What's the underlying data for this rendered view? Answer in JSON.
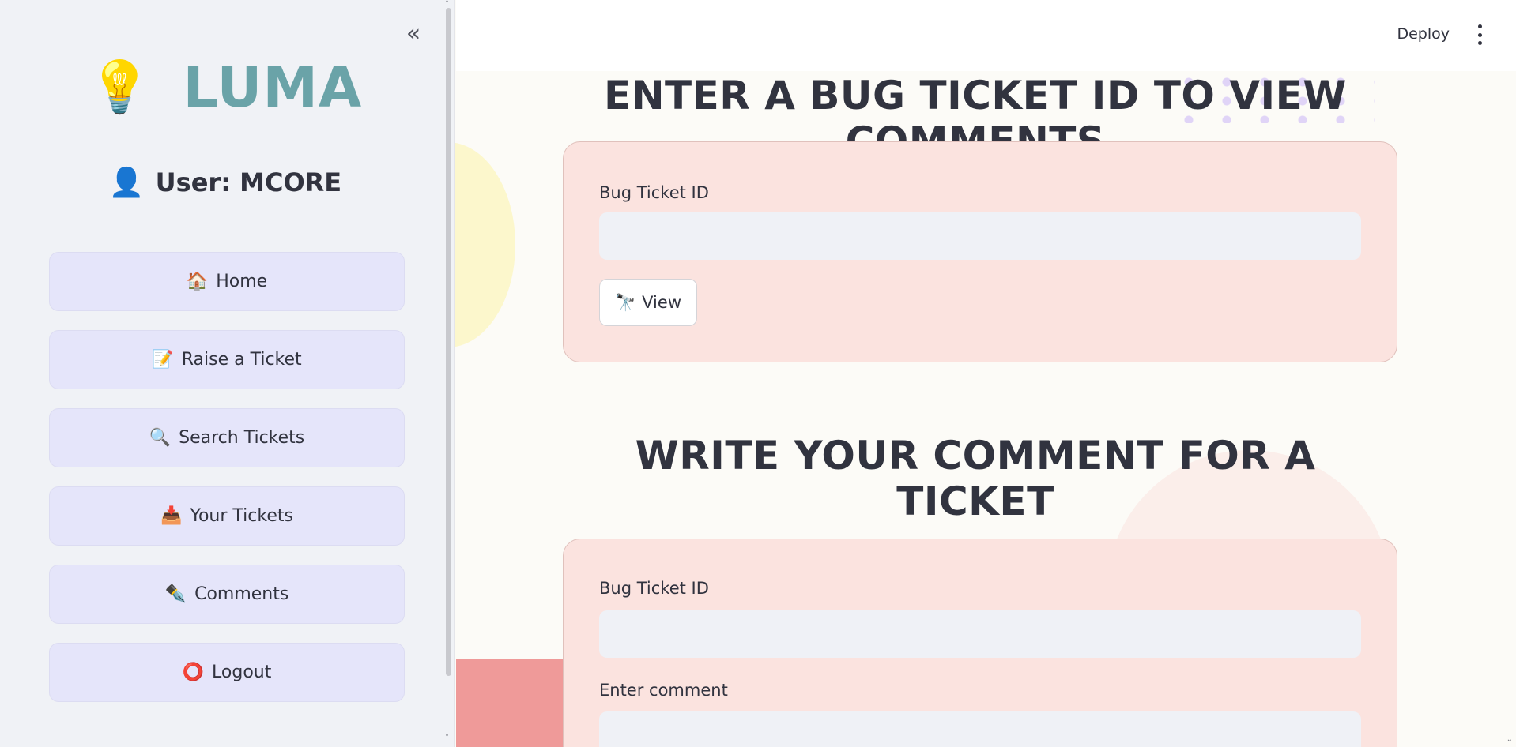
{
  "sidebar": {
    "collapse_icon": "double-chevron-left-icon",
    "logo": {
      "icon": "lightbulb-icon",
      "glyph": "💡",
      "text": "LUMA",
      "color": "#6aa3a8"
    },
    "user": {
      "icon": "user-silhouette-icon",
      "glyph": "👤",
      "label": "User: MCORE"
    },
    "nav": [
      {
        "glyph": "🏠",
        "icon": "house-icon",
        "label": "Home"
      },
      {
        "glyph": "📝",
        "icon": "memo-icon",
        "label": "Raise a Ticket"
      },
      {
        "glyph": "🔍",
        "icon": "magnifier-icon",
        "label": "Search Tickets"
      },
      {
        "glyph": "📥",
        "icon": "inbox-icon",
        "label": "Your Tickets"
      },
      {
        "glyph": "✒️",
        "icon": "pen-nib-icon",
        "label": "Comments"
      },
      {
        "glyph": "⭕",
        "icon": "circle-icon",
        "label": "Logout"
      }
    ]
  },
  "header": {
    "deploy_label": "Deploy",
    "menu_icon": "kebab-menu-icon"
  },
  "view_section": {
    "title": "ENTER A BUG TICKET ID TO VIEW COMMENTS",
    "ticket_label": "Bug Ticket ID",
    "ticket_value": "",
    "button": {
      "glyph": "🔭",
      "icon": "telescope-icon",
      "label": "View"
    }
  },
  "comment_section": {
    "title": "WRITE YOUR COMMENT FOR A TICKET",
    "ticket_label": "Bug Ticket ID",
    "ticket_value": "",
    "comment_label": "Enter comment",
    "comment_value": ""
  },
  "colors": {
    "sidebar_bg": "#f0f2f6",
    "nav_button_bg": "#e5e5fa",
    "card_bg": "#fbe3df",
    "page_bg": "#fcfbf7"
  }
}
